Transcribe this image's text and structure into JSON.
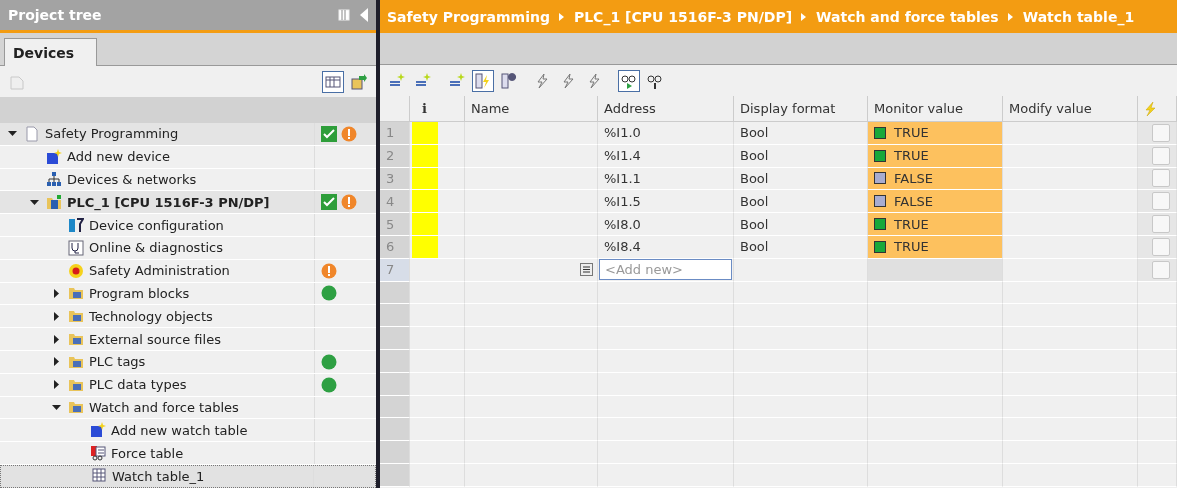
{
  "project_tree": {
    "title": "Project tree",
    "tabs": [
      {
        "label": "Devices",
        "selected": true
      }
    ],
    "toolbar": [
      {
        "kind": "new-group",
        "selected": false,
        "disabled": true
      },
      {
        "kind": "table-view",
        "selected": true,
        "disabled": false
      },
      {
        "kind": "export",
        "selected": false,
        "disabled": false
      }
    ],
    "items": [
      {
        "label": "Safety Programming",
        "kind": "project",
        "expanded": true,
        "selected": false,
        "consistent": true,
        "warning": true,
        "online": false,
        "children": [
          {
            "label": "Add new device",
            "kind": "add",
            "selected": false,
            "consistent": false,
            "warning": false,
            "online": false
          },
          {
            "label": "Devices & networks",
            "kind": "network",
            "selected": false,
            "consistent": false,
            "warning": false,
            "online": false
          },
          {
            "label": "PLC_1 [CPU 1516F-3 PN/DP]",
            "kind": "plc",
            "expanded": true,
            "selected": false,
            "consistent": true,
            "warning": true,
            "online": false,
            "children": [
              {
                "label": "Device configuration",
                "kind": "config",
                "selected": false,
                "consistent": false,
                "warning": false,
                "online": false
              },
              {
                "label": "Online & diagnostics",
                "kind": "diagnostics",
                "selected": false,
                "consistent": false,
                "warning": false,
                "online": false
              },
              {
                "label": "Safety Administration",
                "kind": "safety",
                "selected": false,
                "consistent": false,
                "warning": true,
                "online": false
              },
              {
                "label": "Program blocks",
                "kind": "folder",
                "expanded": false,
                "selected": false,
                "consistent": false,
                "warning": false,
                "online": true
              },
              {
                "label": "Technology objects",
                "kind": "folder",
                "expanded": false,
                "selected": false,
                "consistent": false,
                "warning": false,
                "online": false
              },
              {
                "label": "External source files",
                "kind": "folder",
                "expanded": false,
                "selected": false,
                "consistent": false,
                "warning": false,
                "online": false
              },
              {
                "label": "PLC tags",
                "kind": "folder",
                "expanded": false,
                "selected": false,
                "consistent": false,
                "warning": false,
                "online": true
              },
              {
                "label": "PLC data types",
                "kind": "folder",
                "expanded": false,
                "selected": false,
                "consistent": false,
                "warning": false,
                "online": true
              },
              {
                "label": "Watch and force tables",
                "kind": "folder",
                "expanded": true,
                "selected": false,
                "consistent": false,
                "warning": false,
                "online": false,
                "children": [
                  {
                    "label": "Add new watch table",
                    "kind": "add",
                    "selected": false,
                    "consistent": false,
                    "warning": false,
                    "online": false
                  },
                  {
                    "label": "Force table",
                    "kind": "force-table",
                    "selected": false,
                    "consistent": false,
                    "warning": false,
                    "online": false
                  },
                  {
                    "label": "Watch table_1",
                    "kind": "watch-table",
                    "selected": true,
                    "consistent": false,
                    "warning": false,
                    "online": false
                  }
                ]
              }
            ]
          }
        ]
      }
    ]
  },
  "editor": {
    "breadcrumb": [
      "Safety Programming",
      "PLC_1 [CPU 1516F-3 PN/DP]",
      "Watch and force tables",
      "Watch table_1"
    ],
    "toolbar": [
      {
        "selected": false
      },
      {
        "selected": false
      },
      {
        "selected": false
      },
      {
        "selected": true
      },
      {
        "selected": false
      },
      {
        "selected": false
      },
      {
        "selected": false
      },
      {
        "selected": false
      },
      {
        "selected": true
      },
      {
        "selected": false
      }
    ],
    "table": {
      "columns": [
        "i",
        "Name",
        "Address",
        "Display format",
        "Monitor value",
        "Modify value"
      ],
      "rows": [
        {
          "kind": "tag",
          "number": "1",
          "flagged": true,
          "address": "%I1.0",
          "display_format": "Bool",
          "monitor_value": "TRUE",
          "monitor_on": true,
          "modify": false
        },
        {
          "kind": "tag",
          "number": "2",
          "flagged": true,
          "address": "%I1.4",
          "display_format": "Bool",
          "monitor_value": "TRUE",
          "monitor_on": true,
          "modify": false
        },
        {
          "kind": "tag",
          "number": "3",
          "flagged": true,
          "address": "%I1.1",
          "display_format": "Bool",
          "monitor_value": "FALSE",
          "monitor_on": false,
          "modify": false
        },
        {
          "kind": "tag",
          "number": "4",
          "flagged": true,
          "address": "%I1.5",
          "display_format": "Bool",
          "monitor_value": "FALSE",
          "monitor_on": false,
          "modify": false
        },
        {
          "kind": "tag",
          "number": "5",
          "flagged": true,
          "address": "%I8.0",
          "display_format": "Bool",
          "monitor_value": "TRUE",
          "monitor_on": true,
          "modify": false
        },
        {
          "kind": "tag",
          "number": "6",
          "flagged": true,
          "address": "%I8.4",
          "display_format": "Bool",
          "monitor_value": "TRUE",
          "monitor_on": true,
          "modify": false
        },
        {
          "kind": "add",
          "number": "7",
          "placeholder": "<Add new>",
          "modify": false
        }
      ]
    }
  }
}
